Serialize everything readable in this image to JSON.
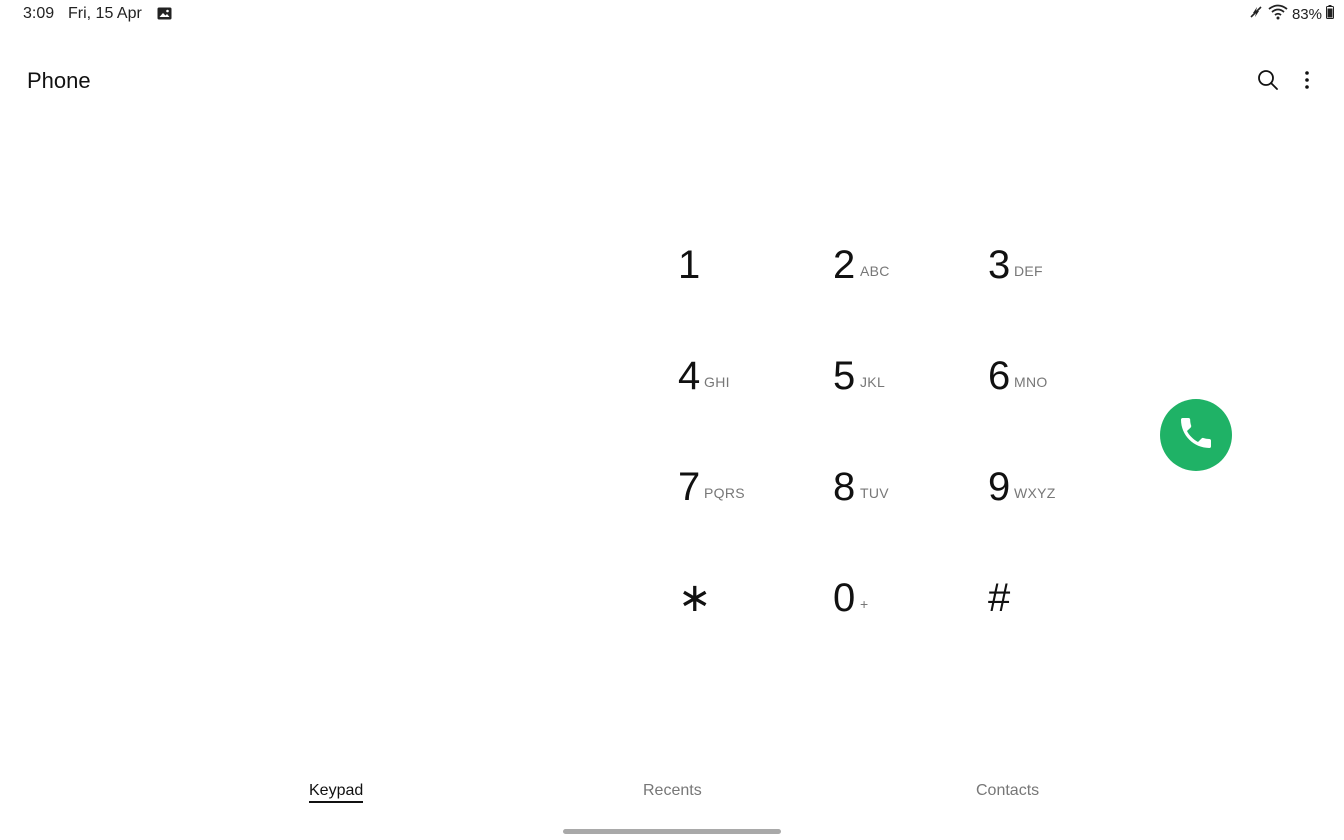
{
  "status_bar": {
    "time": "3:09",
    "date": "Fri, 15 Apr",
    "battery": "83%",
    "icons": [
      "gallery-icon",
      "no-sound-icon",
      "wifi-icon",
      "battery-icon"
    ]
  },
  "app_bar": {
    "title": "Phone",
    "icons": [
      "search-icon",
      "more-options-icon"
    ]
  },
  "keypad": {
    "keys": [
      {
        "digit": "1",
        "letters": ""
      },
      {
        "digit": "2",
        "letters": "ABC"
      },
      {
        "digit": "3",
        "letters": "DEF"
      },
      {
        "digit": "4",
        "letters": "GHI"
      },
      {
        "digit": "5",
        "letters": "JKL"
      },
      {
        "digit": "6",
        "letters": "MNO"
      },
      {
        "digit": "7",
        "letters": "PQRS"
      },
      {
        "digit": "8",
        "letters": "TUV"
      },
      {
        "digit": "9",
        "letters": "WXYZ"
      },
      {
        "digit": "∗",
        "letters": ""
      },
      {
        "digit": "0",
        "letters": "+"
      },
      {
        "digit": "#",
        "letters": ""
      }
    ]
  },
  "call_button": {
    "icon": "phone-icon",
    "color": "#1fb266"
  },
  "tabs": [
    {
      "label": "Keypad",
      "active": true
    },
    {
      "label": "Recents",
      "active": false
    },
    {
      "label": "Contacts",
      "active": false
    }
  ]
}
